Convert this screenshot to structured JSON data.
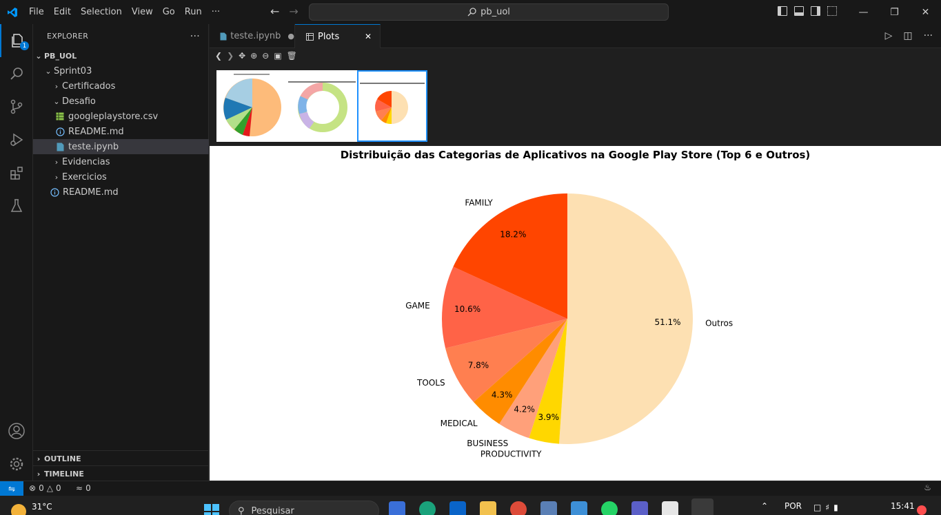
{
  "titlebar": {
    "menu": [
      "File",
      "Edit",
      "Selection",
      "View",
      "Go",
      "Run",
      "···"
    ],
    "search_text": "pb_uol",
    "icons": [
      "back-arrow-icon",
      "forward-arrow-icon",
      "search-icon",
      "toggle-sidebar-icon",
      "toggle-panel-icon",
      "toggle-secondary-sidebar-icon",
      "customize-layout-icon"
    ],
    "window_controls": [
      "—",
      "❐",
      "✕"
    ]
  },
  "activitybar": {
    "explorer_badge": "1",
    "icons": [
      "explorer-icon",
      "search-icon",
      "source-control-icon",
      "run-debug-icon",
      "extensions-icon",
      "testing-icon",
      "account-icon",
      "manage-gear-icon"
    ]
  },
  "sidebar": {
    "title": "EXPLORER",
    "more": "···",
    "root": "PB_UOL",
    "tree": [
      {
        "label": "Sprint03",
        "type": "folder-open"
      },
      {
        "label": "Certificados",
        "type": "folder-closed"
      },
      {
        "label": "Desafio",
        "type": "folder-open"
      },
      {
        "label": "googleplaystore.csv",
        "type": "csv"
      },
      {
        "label": "README.md",
        "type": "info"
      },
      {
        "label": "teste.ipynb",
        "type": "notebook"
      },
      {
        "label": "Evidencias",
        "type": "folder-closed"
      },
      {
        "label": "Exercicios",
        "type": "folder-closed"
      },
      {
        "label": "README.md",
        "type": "info"
      }
    ],
    "outline": "OUTLINE",
    "timeline": "TIMELINE"
  },
  "tabs": [
    {
      "label": "teste.ipynb",
      "modified": "●"
    },
    {
      "label": "Plots",
      "close": "✕"
    }
  ],
  "colors": {
    "accent": "#0078d4",
    "sidebar_bg": "#181818",
    "editor_bg": "#1f1f1f"
  },
  "chart_data": {
    "type": "pie",
    "title": "Distribuição das Categorias de Aplicativos na Google Play Store (Top 6 e Outros)",
    "slices": [
      {
        "label": "Outros",
        "value": 51.1,
        "pct_label": "51.1%",
        "color": "#fde0b2"
      },
      {
        "label": "PRODUCTIVITY",
        "value": 3.9,
        "pct_label": "3.9%",
        "color": "#ffd700"
      },
      {
        "label": "BUSINESS",
        "value": 4.2,
        "pct_label": "4.2%",
        "color": "#ffa07a"
      },
      {
        "label": "MEDICAL",
        "value": 4.3,
        "pct_label": "4.3%",
        "color": "#ff8c00"
      },
      {
        "label": "TOOLS",
        "value": 7.8,
        "pct_label": "7.8%",
        "color": "#ff7f50"
      },
      {
        "label": "GAME",
        "value": 10.6,
        "pct_label": "10.6%",
        "color": "#ff6347"
      },
      {
        "label": "FAMILY",
        "value": 18.2,
        "pct_label": "18.2%",
        "color": "#ff4500"
      }
    ],
    "start_angle_deg": 90,
    "direction": "clockwise"
  },
  "statusbar": {
    "errors": "0",
    "warnings": "0",
    "ports": "0"
  },
  "taskbar": {
    "temperature": "31°C",
    "search_placeholder": "Pesquisar",
    "language": "POR",
    "time": "15:41"
  }
}
